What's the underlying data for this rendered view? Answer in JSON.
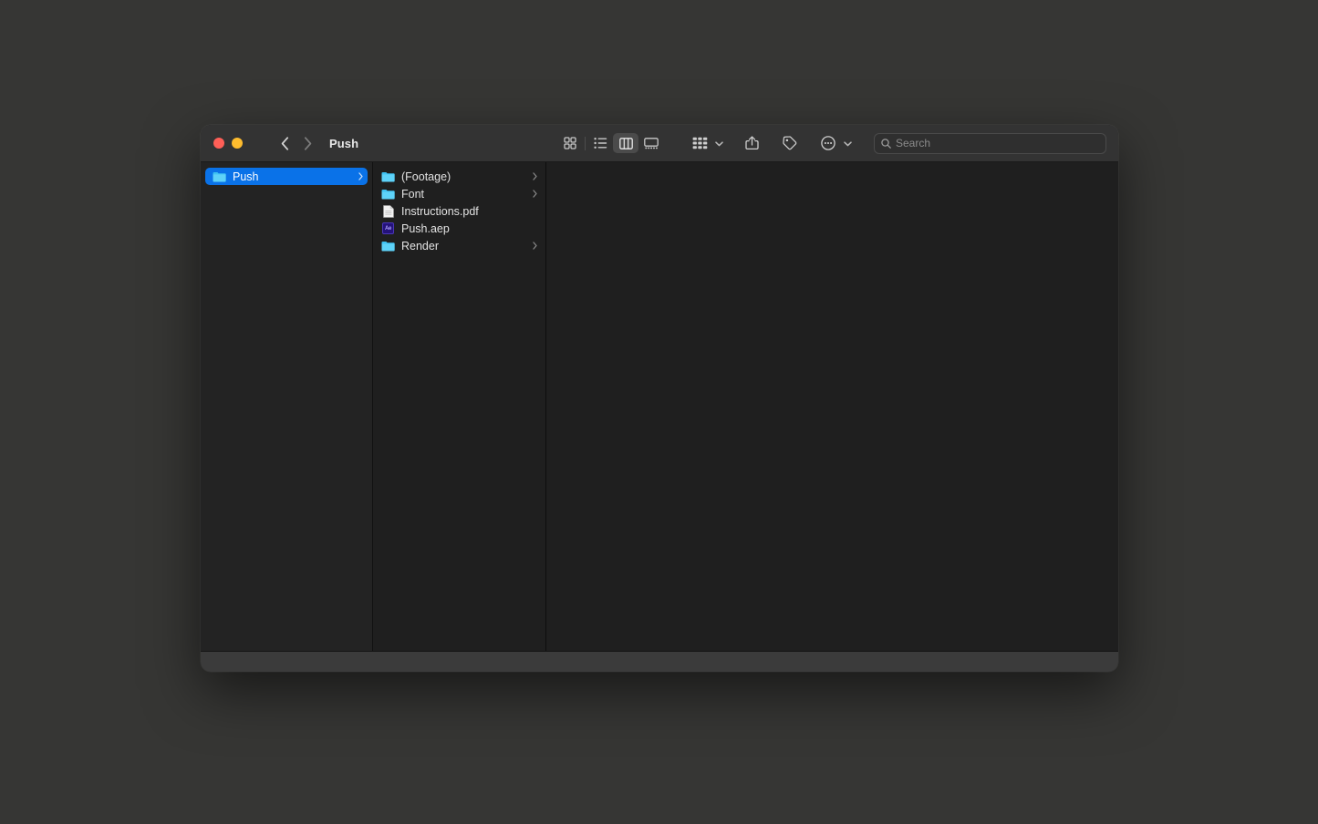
{
  "window": {
    "title": "Push",
    "traffic_lights": [
      {
        "name": "close",
        "color": "#ff5f57"
      },
      {
        "name": "minimize",
        "color": "#febc2e"
      },
      {
        "name": "maximize",
        "color": "#28c840"
      }
    ],
    "nav": {
      "back_label": "Back",
      "forward_label": "Forward"
    }
  },
  "toolbar": {
    "view_modes": [
      {
        "name": "icon-view",
        "label": "Icon View",
        "active": false
      },
      {
        "name": "list-view",
        "label": "List View",
        "active": false
      },
      {
        "name": "column-view",
        "label": "Column View",
        "active": true
      },
      {
        "name": "gallery-view",
        "label": "Gallery View",
        "active": false
      }
    ],
    "group_label": "Group",
    "share_label": "Share",
    "tag_label": "Tags",
    "more_label": "More"
  },
  "search": {
    "placeholder": "Search",
    "value": ""
  },
  "columns": {
    "sidebar": {
      "items": [
        {
          "label": "Push",
          "icon": "folder-icon",
          "selected": true,
          "has_chevron": true
        }
      ]
    },
    "files": {
      "items": [
        {
          "label": "(Footage)",
          "icon": "folder-icon",
          "selected": false,
          "has_chevron": true
        },
        {
          "label": "Font",
          "icon": "folder-icon",
          "selected": false,
          "has_chevron": true
        },
        {
          "label": "Instructions.pdf",
          "icon": "document-icon",
          "selected": false,
          "has_chevron": false
        },
        {
          "label": "Push.aep",
          "icon": "after-effects-icon",
          "icon_text": "Ae",
          "selected": false,
          "has_chevron": false
        },
        {
          "label": "Render",
          "icon": "folder-icon",
          "selected": false,
          "has_chevron": true
        }
      ]
    },
    "preview": {
      "content": ""
    }
  },
  "statusbar": {
    "text": ""
  },
  "colors": {
    "desktop": "#363634",
    "titlebar": "#333333",
    "sidebar": "#232323",
    "column": "#1f1f1f",
    "selection": "#0a72e8",
    "folder": "#3ec2f2",
    "statusbar": "#3b3b3b"
  }
}
